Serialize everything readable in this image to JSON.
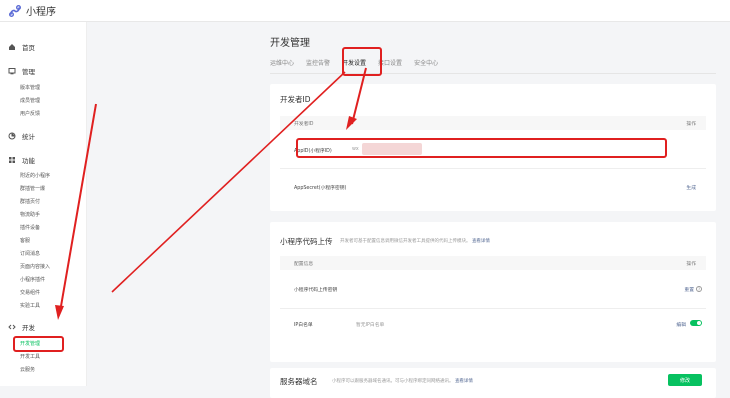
{
  "topbar": {
    "app_title": "小程序"
  },
  "sidebar": {
    "home": "首页",
    "manage": "管理",
    "manage_items": [
      "版本管理",
      "成员管理",
      "用户反馈"
    ],
    "stats": "统计",
    "features": "功能",
    "feature_items": [
      "附近的小程序",
      "群插管一爆",
      "群插页付",
      "物流助手",
      "插件设备",
      "客服",
      "订阅消息",
      "页面内容接入",
      "小程序插件",
      "交易组件",
      "实验工具"
    ],
    "dev": "开发",
    "dev_items": [
      "开发管理",
      "开发工具",
      "云服务"
    ]
  },
  "main": {
    "title": "开发管理",
    "tabs": [
      "运维中心",
      "监控告警",
      "开发设置",
      "接口设置",
      "安全中心"
    ],
    "card1": {
      "title": "开发者ID",
      "col1": "开发者ID",
      "col2": "操作",
      "appid_label": "AppID(小程序ID)",
      "appid_value": "wx",
      "secret_label": "AppSecret(小程序密钥)",
      "secret_action": "生成"
    },
    "card2": {
      "title": "小程序代码上传",
      "desc": "开发者可基于配置信息调用微信开发者工具提供的代码上传模块。",
      "desc_link": "查看详情",
      "col1": "配置信息",
      "col2": "操作",
      "key_label": "小程序代码上传密钥",
      "key_action": "重置",
      "ip_label": "IP白名单",
      "ip_value": "暂无IP白名单",
      "ip_action": "编辑"
    },
    "card3": {
      "title": "服务器域名",
      "desc": "小程序可以跟服务器域名通讯。可与小程序绑定同网络通讯。",
      "desc_link": "查看详情",
      "button": "修改"
    }
  },
  "colors": {
    "accent": "#07c160",
    "link": "#576b95",
    "highlight": "#e02020"
  }
}
